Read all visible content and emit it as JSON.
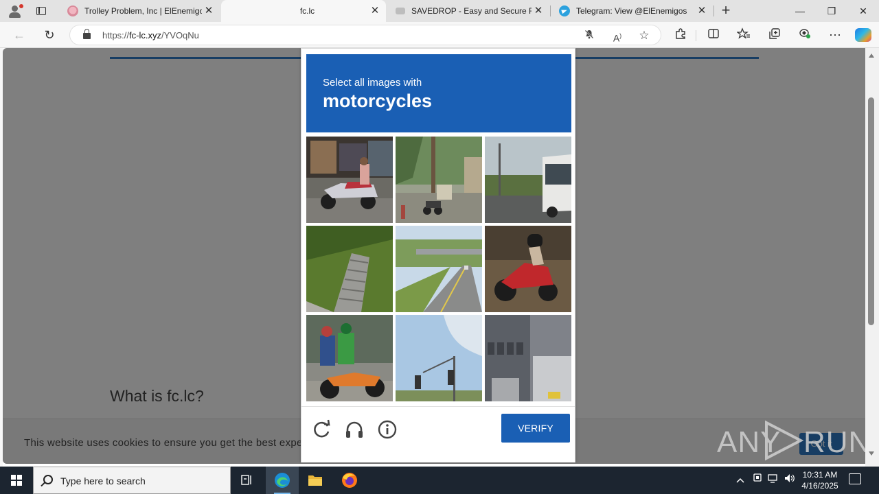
{
  "browser": {
    "tabs": [
      {
        "title": "Trolley Problem, Inc | ElEnemigos",
        "active": false,
        "icon": "trolley-favicon"
      },
      {
        "title": "fc.lc",
        "active": true,
        "icon": "fclc-favicon"
      },
      {
        "title": "SAVEDROP - Easy and Secure File",
        "active": false,
        "icon": "savedrop-favicon"
      },
      {
        "title": "Telegram: View @ElEnemigos",
        "active": false,
        "icon": "telegram-favicon"
      }
    ],
    "close_glyph": "✕",
    "new_tab_glyph": "+",
    "window": {
      "minimize": "—",
      "restore": "❐",
      "close": "✕"
    },
    "address": {
      "scheme": "https://",
      "host": "fc-lc.xyz",
      "path": "/YVOqNu"
    }
  },
  "page": {
    "heading": "What is fc.lc?",
    "cookie_text": "This website uses cookies to ensure you get the best experience on our website.",
    "cookie_button": "Got it"
  },
  "captcha": {
    "prompt": "Select all images with",
    "target": "motorcycles",
    "tiles": [
      {
        "index": 1,
        "contains_target": true
      },
      {
        "index": 2,
        "contains_target": true
      },
      {
        "index": 3,
        "contains_target": false
      },
      {
        "index": 4,
        "contains_target": false
      },
      {
        "index": 5,
        "contains_target": false
      },
      {
        "index": 6,
        "contains_target": true
      },
      {
        "index": 7,
        "contains_target": true
      },
      {
        "index": 8,
        "contains_target": false
      },
      {
        "index": 9,
        "contains_target": false
      }
    ],
    "verify_label": "VERIFY",
    "accent_color": "#1a5fb4"
  },
  "watermark": {
    "left": "ANY",
    "right": "RUN"
  },
  "taskbar": {
    "search_placeholder": "Type here to search",
    "time": "10:31 AM",
    "date": "4/16/2025"
  }
}
